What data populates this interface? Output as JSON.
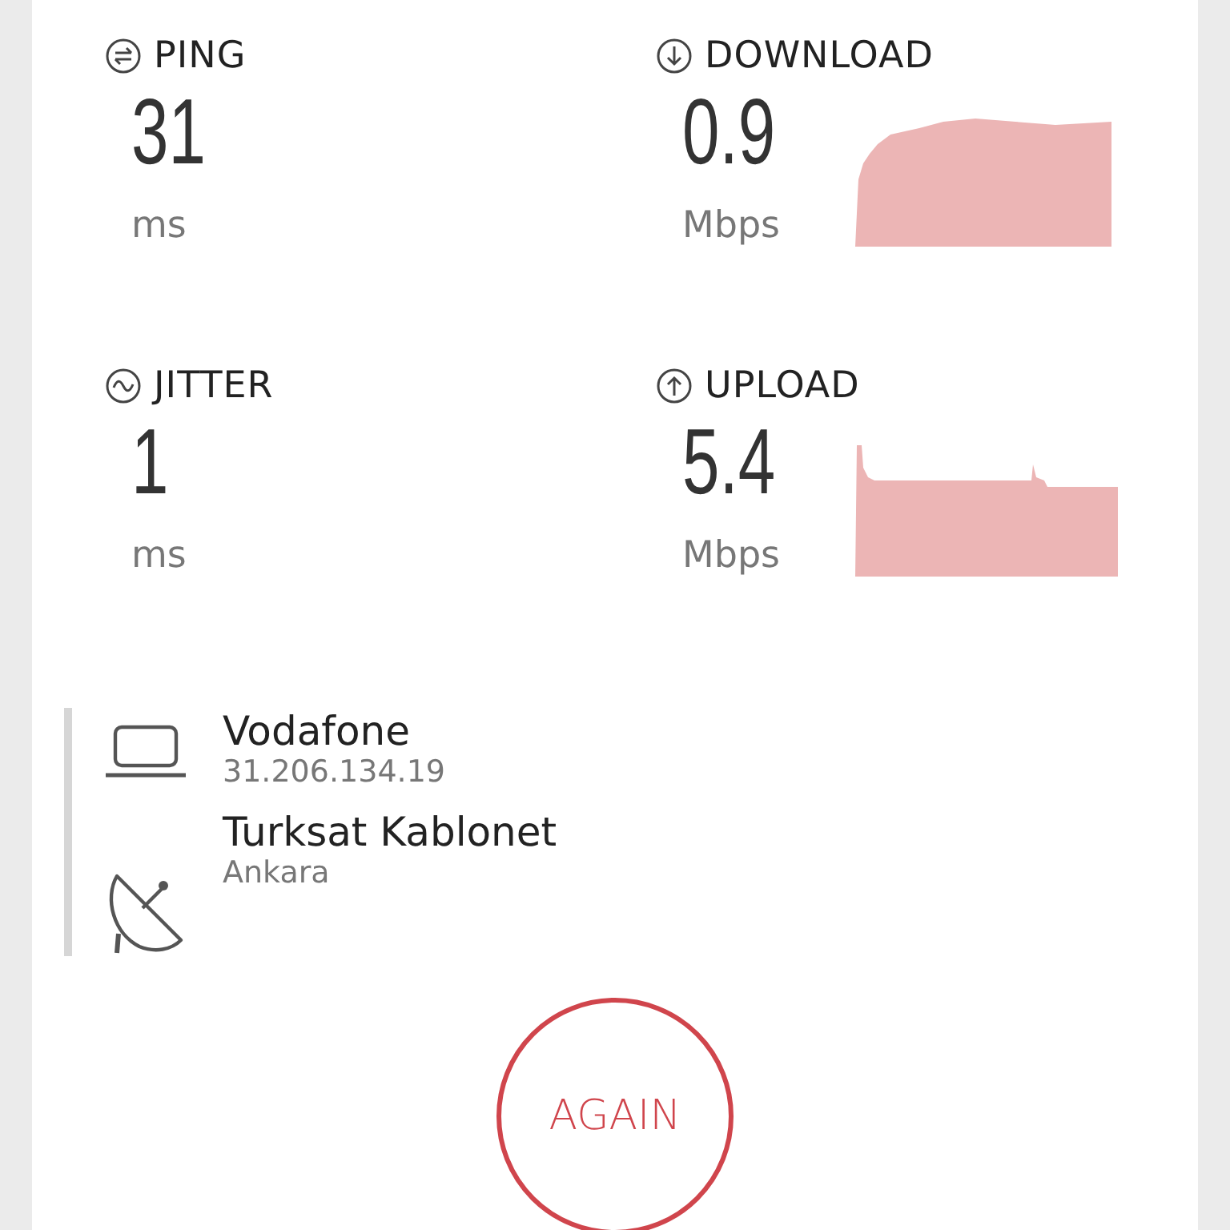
{
  "metrics": [
    {
      "kind": "ping",
      "label": "PING",
      "value": "31",
      "unit": "ms"
    },
    {
      "kind": "download",
      "label": "DOWNLOAD",
      "value": "0.9",
      "unit": "Mbps"
    },
    {
      "kind": "jitter",
      "label": "JITTER",
      "value": "1",
      "unit": "ms"
    },
    {
      "kind": "upload",
      "label": "UPLOAD",
      "value": "5.4",
      "unit": "Mbps"
    }
  ],
  "connections": [
    {
      "kind": "client",
      "name": "Vodafone",
      "detail": "31.206.134.19"
    },
    {
      "kind": "server",
      "name": "Turksat Kablonet",
      "detail": "Ankara"
    }
  ],
  "action_button": "AGAIN"
}
